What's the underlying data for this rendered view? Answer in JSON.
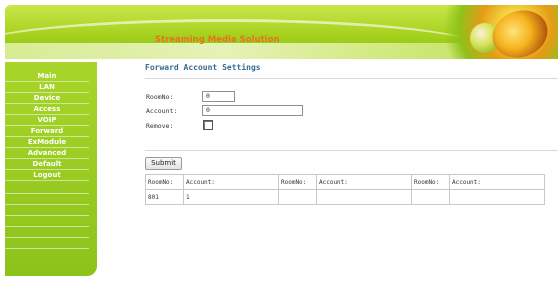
{
  "header": {
    "title": "Streaming Media Solution",
    "colors": {
      "brand_green": "#a6d21f",
      "title_orange": "#e8731a"
    }
  },
  "sidebar": {
    "items": [
      {
        "label": "Main"
      },
      {
        "label": "LAN"
      },
      {
        "label": "Device"
      },
      {
        "label": "Access"
      },
      {
        "label": "VOIP"
      },
      {
        "label": "Forward"
      },
      {
        "label": "ExModule"
      },
      {
        "label": "Advanced"
      },
      {
        "label": "Default"
      },
      {
        "label": "Logout"
      }
    ]
  },
  "main": {
    "title": "Forward Account Settings",
    "form": {
      "room_no_label": "RoomNo:",
      "room_no_value": "0",
      "account_label": "Account:",
      "account_value": "0",
      "remove_label": "Remove:",
      "remove_checked": false
    },
    "submit_label": "Submit",
    "table": {
      "headers": [
        "RoomNo:",
        "Account:",
        "RoomNo:",
        "Account:",
        "RoomNo:",
        "Account:"
      ],
      "rows": [
        [
          "801",
          "1",
          "",
          "",
          "",
          ""
        ]
      ]
    }
  }
}
